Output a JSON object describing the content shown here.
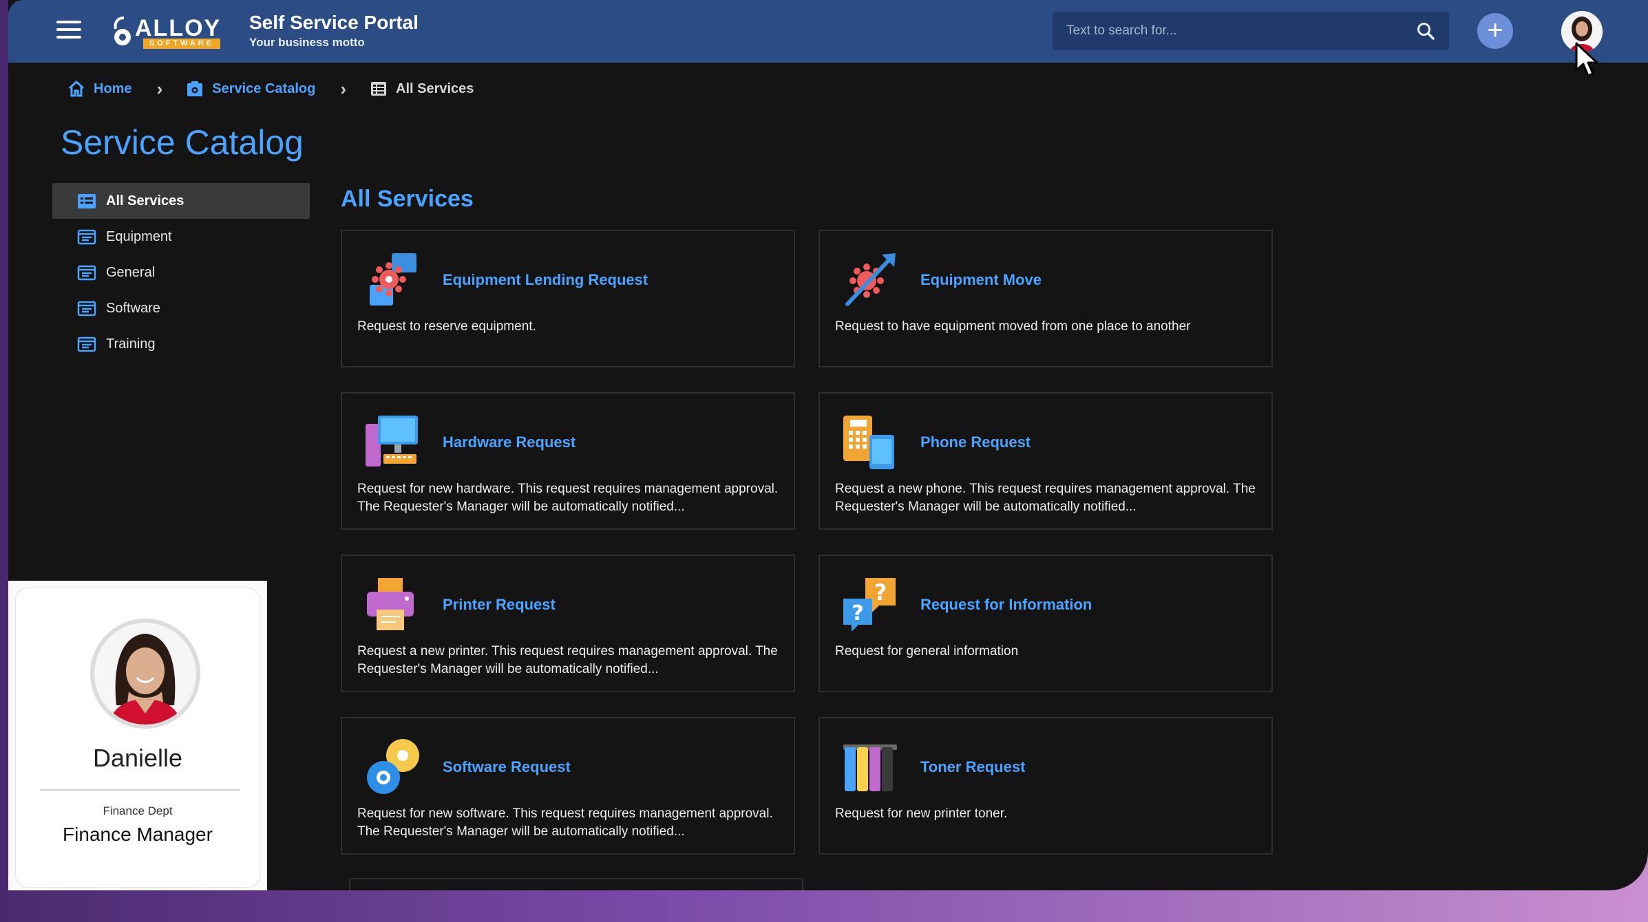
{
  "app": {
    "logo_word": "ALLOY",
    "logo_sub": "SOFTWARE",
    "title": "Self Service Portal",
    "motto": "Your business motto"
  },
  "search": {
    "placeholder": "Text to search for..."
  },
  "breadcrumb": [
    {
      "label": "Home",
      "icon": "home-icon"
    },
    {
      "label": "Service Catalog",
      "icon": "service-catalog-icon"
    },
    {
      "label": "All Services",
      "icon": "list-icon"
    }
  ],
  "page_title": "Service Catalog",
  "sidebar": {
    "items": [
      {
        "label": "All Services",
        "active": true
      },
      {
        "label": "Equipment"
      },
      {
        "label": "General"
      },
      {
        "label": "Software"
      },
      {
        "label": "Training"
      }
    ]
  },
  "section_title": "All Services",
  "services": [
    {
      "title": "Equipment Lending Request",
      "description": "Request to reserve equipment.",
      "icon": "equipment-lending-icon"
    },
    {
      "title": "Equipment Move",
      "description": "Request to have equipment moved from one place to another",
      "icon": "equipment-move-icon"
    },
    {
      "title": "Hardware Request",
      "description": "Request for new hardware. This request requires management approval. The Requester's Manager will be automatically notified...",
      "icon": "hardware-icon"
    },
    {
      "title": "Phone Request",
      "description": "Request a new phone. This request requires management approval. The Requester's Manager will be automatically notified...",
      "icon": "phone-icon"
    },
    {
      "title": "Printer Request",
      "description": "Request a new printer. This request requires management approval. The Requester's Manager will be automatically notified...",
      "icon": "printer-icon"
    },
    {
      "title": "Request for Information",
      "description": "Request for general information",
      "icon": "information-icon"
    },
    {
      "title": "Software Request",
      "description": "Request for new software. This request requires management approval. The Requester's Manager will be automatically notified...",
      "icon": "software-icon"
    },
    {
      "title": "Toner Request",
      "description": "Request for new printer toner.",
      "icon": "toner-icon"
    }
  ],
  "profile": {
    "name": "Danielle",
    "department": "Finance Dept",
    "role": "Finance Manager"
  },
  "colors": {
    "topbar": "#2c4c86",
    "accent": "#4aa3ff",
    "background": "#141414",
    "logo_orange": "#f3a623"
  }
}
